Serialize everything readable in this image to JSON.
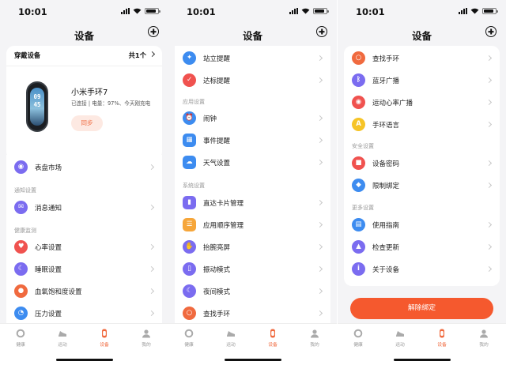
{
  "status_bar": {
    "time": "10:01"
  },
  "header": {
    "title": "设备"
  },
  "wearables": {
    "title": "穿戴设备",
    "count": "共1个",
    "device_name": "小米手环7",
    "device_status": "已连接 | 电量：97%、今天刚充电",
    "band_time_hour": "09",
    "band_time_min": "45",
    "sync_label": "同步"
  },
  "screen1": {
    "watchface": "表盘市场",
    "section_notify": "通知设置",
    "notify": "消息通知",
    "section_health": "健康监测",
    "health": [
      "心率设置",
      "睡眠设置",
      "血氧饱和度设置",
      "压力设置"
    ]
  },
  "screen2": {
    "top": [
      "站立提醒",
      "达标提醒"
    ],
    "section_apps": "应用设置",
    "apps": [
      "闹钟",
      "事件提醒",
      "天气设置"
    ],
    "section_system": "系统设置",
    "system": [
      "直达卡片管理",
      "应用顺序管理",
      "抬腕亮屏",
      "振动模式",
      "夜间模式",
      "查找手环"
    ]
  },
  "screen3": {
    "top": [
      "查找手环",
      "蓝牙广播",
      "运动心率广播",
      "手环语言"
    ],
    "section_security": "安全设置",
    "security": [
      "设备密码",
      "限制绑定"
    ],
    "section_more": "更多设置",
    "more": [
      "使用指南",
      "检查更新",
      "关于设备"
    ],
    "unbind_label": "解除绑定"
  },
  "tabbar": {
    "tabs": [
      "健康",
      "运动",
      "设备",
      "我的"
    ],
    "active_index": 2
  },
  "colors": {
    "accent": "#f5592e",
    "purple": "#7b6cf0",
    "red": "#f0524f",
    "orange": "#f6a63a",
    "blue": "#3d8cf0",
    "yellow": "#f6c427"
  },
  "icons": {
    "screen1": [
      "watch-face-icon",
      "message-icon",
      "heart-icon",
      "moon-icon",
      "drop-icon",
      "gauge-icon"
    ],
    "screen2": [
      "stand-icon",
      "target-icon",
      "alarm-icon",
      "calendar-icon",
      "cloud-icon",
      "card-icon",
      "list-order-icon",
      "raise-wrist-icon",
      "vibration-icon",
      "night-moon-icon",
      "search-icon"
    ],
    "screen3": [
      "search-icon",
      "bluetooth-icon",
      "broadcast-icon",
      "language-icon",
      "lock-icon",
      "shield-icon",
      "book-icon",
      "cloud-upload-icon",
      "info-icon"
    ]
  }
}
